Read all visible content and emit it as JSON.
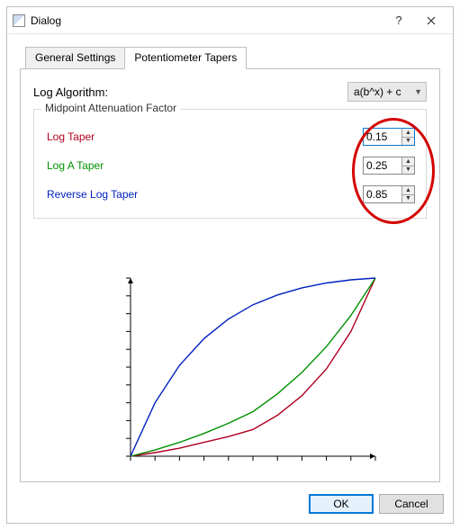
{
  "window": {
    "title": "Dialog"
  },
  "tabs": {
    "general": "General Settings",
    "pot": "Potentiometer Tapers"
  },
  "algo": {
    "label": "Log Algorithm:",
    "value": "a(b^x) + c"
  },
  "group": {
    "legend": "Midpoint Attenuation Factor"
  },
  "tapers": {
    "log": {
      "label": "Log Taper",
      "value": "0.15"
    },
    "loga": {
      "label": "Log A Taper",
      "value": "0.25"
    },
    "revlog": {
      "label": "Reverse Log Taper",
      "value": "0.85"
    }
  },
  "buttons": {
    "ok": "OK",
    "cancel": "Cancel"
  },
  "chart_data": {
    "type": "line",
    "title": "",
    "xlabel": "",
    "ylabel": "",
    "xlim": [
      0,
      1
    ],
    "ylim": [
      0,
      1
    ],
    "xticks": [
      0,
      0.1,
      0.2,
      0.3,
      0.4,
      0.5,
      0.6,
      0.7,
      0.8,
      0.9,
      1.0
    ],
    "yticks": [
      0,
      0.1,
      0.2,
      0.3,
      0.4,
      0.5,
      0.6,
      0.7,
      0.8,
      0.9,
      1.0
    ],
    "series": [
      {
        "name": "Log Taper",
        "color": "#b00020",
        "midpoint": 0.15,
        "x": [
          0,
          0.1,
          0.2,
          0.3,
          0.4,
          0.5,
          0.6,
          0.7,
          0.8,
          0.9,
          1.0
        ],
        "y": [
          0.0,
          0.02,
          0.045,
          0.078,
          0.11,
          0.15,
          0.23,
          0.34,
          0.49,
          0.7,
          1.0
        ]
      },
      {
        "name": "Log A Taper",
        "color": "#009000",
        "midpoint": 0.25,
        "x": [
          0,
          0.1,
          0.2,
          0.3,
          0.4,
          0.5,
          0.6,
          0.7,
          0.8,
          0.9,
          1.0
        ],
        "y": [
          0.0,
          0.035,
          0.078,
          0.128,
          0.185,
          0.25,
          0.35,
          0.47,
          0.615,
          0.79,
          1.0
        ]
      },
      {
        "name": "Reverse Log Taper",
        "color": "#0020c0",
        "midpoint": 0.85,
        "x": [
          0,
          0.1,
          0.2,
          0.3,
          0.4,
          0.5,
          0.6,
          0.7,
          0.8,
          0.9,
          1.0
        ],
        "y": [
          0.0,
          0.3,
          0.51,
          0.66,
          0.77,
          0.85,
          0.905,
          0.945,
          0.972,
          0.99,
          1.0
        ]
      }
    ]
  }
}
